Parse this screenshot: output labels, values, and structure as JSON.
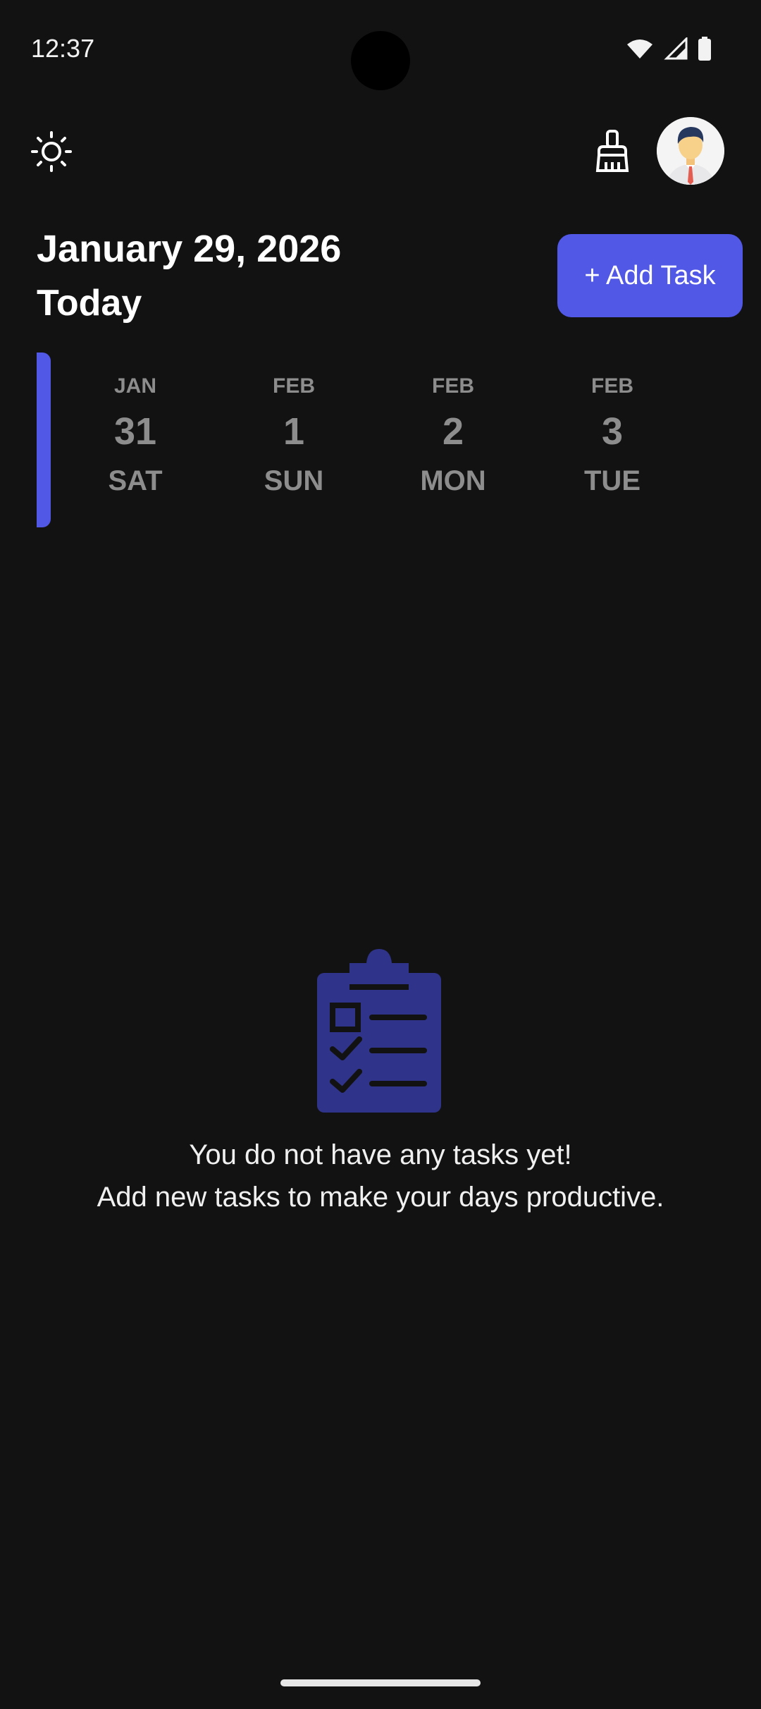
{
  "status_bar": {
    "time": "12:37"
  },
  "header": {
    "date_title": "January 29, 2026",
    "today_label": "Today",
    "add_task_label": "+ Add Task"
  },
  "date_strip": [
    {
      "month": "JAN",
      "day": "31",
      "weekday": "SAT"
    },
    {
      "month": "FEB",
      "day": "1",
      "weekday": "SUN"
    },
    {
      "month": "FEB",
      "day": "2",
      "weekday": "MON"
    },
    {
      "month": "FEB",
      "day": "3",
      "weekday": "TUE"
    }
  ],
  "empty_state": {
    "line1": "You do not have any tasks yet!",
    "line2": "Add new tasks to make your days productive."
  },
  "colors": {
    "background": "#121212",
    "accent": "#5258e6",
    "muted_text": "#8d8d8d",
    "clipboard": "#2f348a"
  },
  "icons": {
    "theme": "sun-icon",
    "clean": "broom-icon",
    "avatar": "user-avatar-icon",
    "empty": "clipboard-checklist-icon"
  }
}
